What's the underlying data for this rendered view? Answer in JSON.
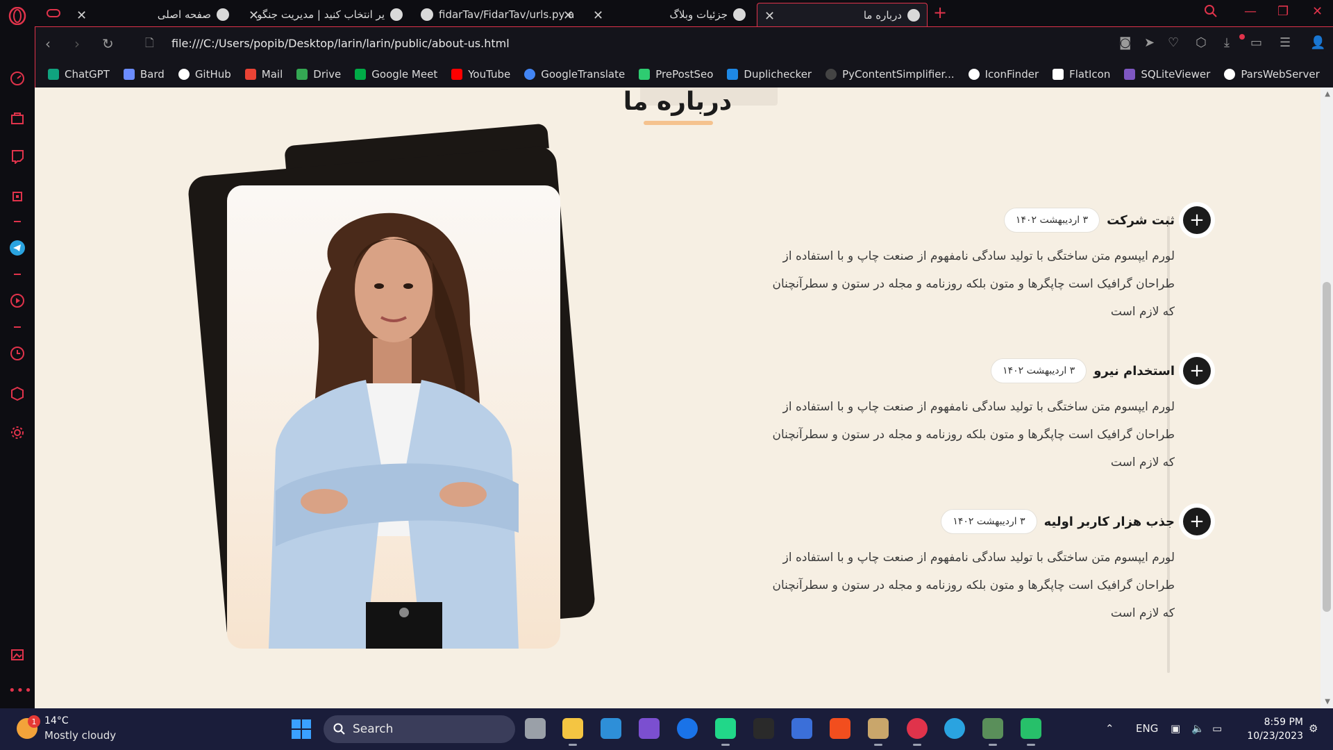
{
  "browser": {
    "tabs": [
      {
        "label": "صفحه اصلی"
      },
      {
        "label": "یر انتخاب کنید | مدیریت جنگو"
      },
      {
        "label": "fidarTav/FidarTav/urls.py at"
      },
      {
        "label": "جزئیات وبلاگ"
      },
      {
        "label": "درباره ما"
      }
    ],
    "url": "file:///C:/Users/popib/Desktop/larin/larin/public/about-us.html",
    "bookmarks": [
      {
        "label": "ChatGPT",
        "color": "#10a37f"
      },
      {
        "label": "Bard",
        "color": "#6b8cff"
      },
      {
        "label": "GitHub",
        "color": "#ffffff"
      },
      {
        "label": "Mail",
        "color": "#ea4335"
      },
      {
        "label": "Drive",
        "color": "#34a853"
      },
      {
        "label": "Google Meet",
        "color": "#00ac47"
      },
      {
        "label": "YouTube",
        "color": "#ff0000"
      },
      {
        "label": "GoogleTranslate",
        "color": "#4285f4"
      },
      {
        "label": "PrePostSeo",
        "color": "#2ecc71"
      },
      {
        "label": "Duplichecker",
        "color": "#1e88e5"
      },
      {
        "label": "PyContentSimplifier...",
        "color": "#444444"
      },
      {
        "label": "IconFinder",
        "color": "#ffffff"
      },
      {
        "label": "FlatIcon",
        "color": "#ffffff"
      },
      {
        "label": "SQLiteViewer",
        "color": "#7e57c2"
      },
      {
        "label": "ParsWebServer",
        "color": "#ffffff"
      }
    ]
  },
  "page": {
    "title": "درباره ما",
    "timeline": [
      {
        "title": "ثبت شرکت",
        "date": "۳ اردیبهشت ۱۴۰۲",
        "text": "لورم ایپسوم متن ساختگی با تولید سادگی نامفهوم از صنعت چاپ و با استفاده از طراحان گرافیک است چاپگرها و متون بلکه روزنامه و مجله در ستون و سطرآنچنان که لازم است"
      },
      {
        "title": "استخدام نیرو",
        "date": "۳ اردیبهشت ۱۴۰۲",
        "text": "لورم ایپسوم متن ساختگی با تولید سادگی نامفهوم از صنعت چاپ و با استفاده از طراحان گرافیک است چاپگرها و متون بلکه روزنامه و مجله در ستون و سطرآنچنان که لازم است"
      },
      {
        "title": "جذب هزار کاربر اولیه",
        "date": "۳ اردیبهشت ۱۴۰۲",
        "text": "لورم ایپسوم متن ساختگی با تولید سادگی نامفهوم از صنعت چاپ و با استفاده از طراحان گرافیک است چاپگرها و متون بلکه روزنامه و مجله در ستون و سطرآنچنان که لازم است"
      }
    ],
    "plus_symbol": "+"
  },
  "taskbar": {
    "weather_temp": "14°C",
    "weather_desc": "Mostly cloudy",
    "weather_badge": "1",
    "search_label": "Search",
    "lang": "ENG",
    "time": "8:59 PM",
    "date": "10/23/2023"
  }
}
